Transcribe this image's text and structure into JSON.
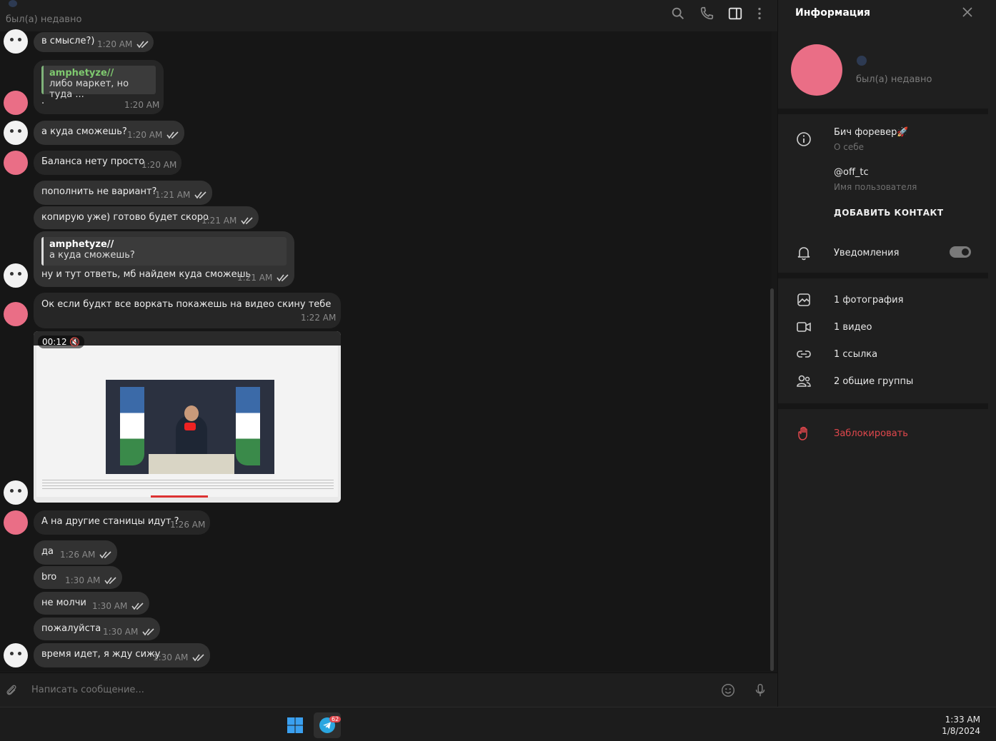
{
  "header": {
    "status": "был(а) недавно",
    "icons": [
      "search-icon",
      "phone-icon",
      "sidebar-toggle-icon",
      "more-icon"
    ]
  },
  "messages": [
    {
      "id": "m1",
      "dir": "out",
      "text": "в смысле?)",
      "time": "1:20 AM"
    },
    {
      "id": "m2",
      "dir": "in",
      "quote_name": "amphetyze//",
      "quote_text": "либо маркет, но туда ...",
      "text": ".",
      "time": "1:20 AM"
    },
    {
      "id": "m3",
      "dir": "out",
      "text": "а куда сможешь?",
      "time": "1:20 AM"
    },
    {
      "id": "m4",
      "dir": "in",
      "text": "Баланса нету просто",
      "time": "1:20 AM"
    },
    {
      "id": "m5",
      "dir": "out",
      "text": "пополнить не вариант?",
      "time": "1:21 AM"
    },
    {
      "id": "m6",
      "dir": "out",
      "text": "копирую уже) готово будет скоро",
      "time": "1:21 AM"
    },
    {
      "id": "m7",
      "dir": "out",
      "quote_name": "amphetyze//",
      "quote_text": "а куда сможешь?",
      "text": "ну и тут ответь, мб найдем куда сможешь",
      "time": "1:21 AM"
    },
    {
      "id": "m8",
      "dir": "in",
      "text": "Ок если будкт все воркать покажешь на видео скину тебе",
      "time": "1:22 AM"
    },
    {
      "id": "m9",
      "dir": "out",
      "video_duration": "00:12"
    },
    {
      "id": "m10",
      "dir": "in",
      "text": "А на другие станицы идут ?",
      "time": "1:26 AM"
    },
    {
      "id": "m11",
      "dir": "out",
      "text": "да",
      "time": "1:26 AM"
    },
    {
      "id": "m12",
      "dir": "out",
      "text": "bro",
      "time": "1:30 AM"
    },
    {
      "id": "m13",
      "dir": "out",
      "text": "не молчи",
      "time": "1:30 AM"
    },
    {
      "id": "m14",
      "dir": "out",
      "text": "пожалуйста",
      "time": "1:30 AM"
    },
    {
      "id": "m15",
      "dir": "out",
      "text": "время идет, я жду сижу",
      "time": "1:30 AM"
    }
  ],
  "composer": {
    "placeholder": "Написать сообщение..."
  },
  "info": {
    "title": "Информация",
    "status": "был(а) недавно",
    "about": "Бич форевер",
    "about_label": "О себе",
    "username": "@off_tc",
    "username_label": "Имя пользователя",
    "add_contact": "ДОБАВИТЬ КОНТАКТ",
    "notifications": "Уведомления",
    "notifications_on": true,
    "media": [
      {
        "icon": "photo-icon",
        "label": "1 фотография"
      },
      {
        "icon": "video-icon",
        "label": "1 видео"
      },
      {
        "icon": "link-icon",
        "label": "1 ссылка"
      },
      {
        "icon": "group-icon",
        "label": "2 общие группы"
      }
    ],
    "block": "Заблокировать",
    "colors": {
      "block": "#e0474c",
      "avatar": "#ea6e86"
    }
  },
  "taskbar": {
    "badge": "62",
    "time": "1:33 AM",
    "date": "1/8/2024"
  }
}
